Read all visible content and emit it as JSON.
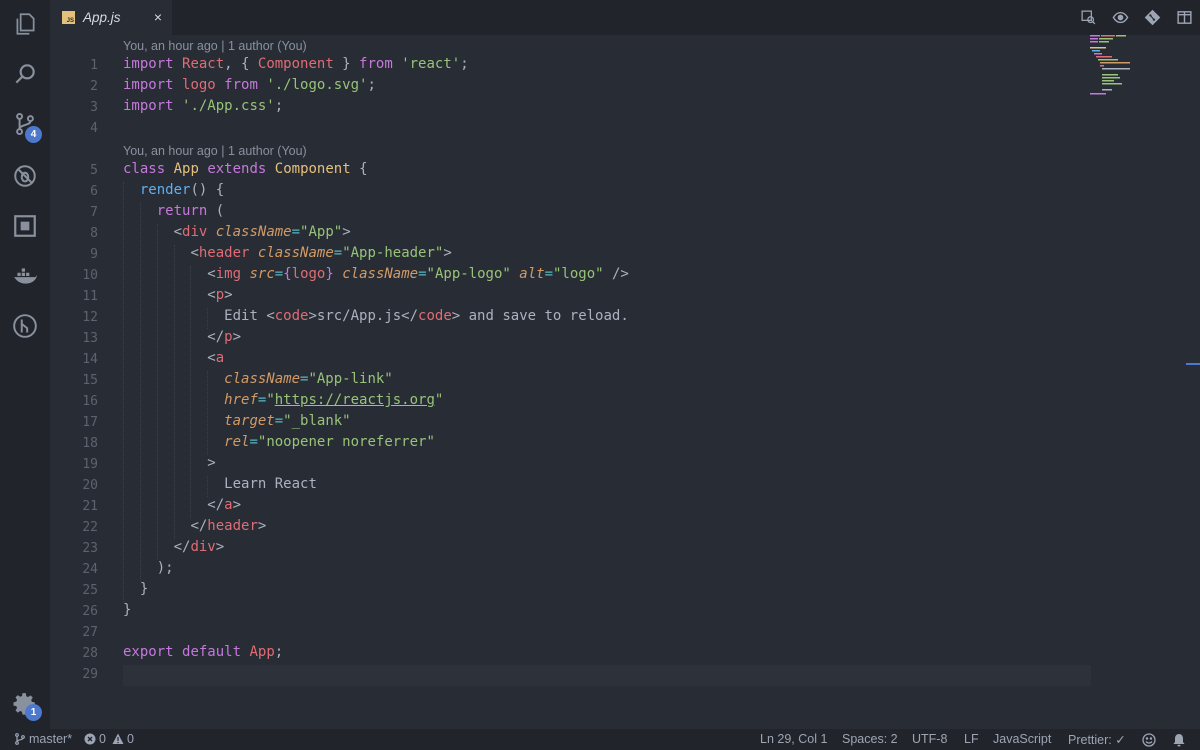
{
  "activity_bar": {
    "scm_badge": "4",
    "settings_badge": "1",
    "items": [
      "explorer-icon",
      "search-icon",
      "source-control-icon",
      "debug-icon",
      "extensions-icon",
      "docker-icon",
      "gitlens-icon",
      "gear-icon"
    ]
  },
  "tab": {
    "label": "App.js",
    "icon_text": "JS",
    "close": "×"
  },
  "editor_actions": [
    "open-changes-icon",
    "preview-icon",
    "git-compare-icon",
    "split-editor-icon"
  ],
  "codelens": {
    "first": "You, an hour ago | 1 author (You)",
    "second": "You, an hour ago | 1 author (You)"
  },
  "line_numbers": [
    "1",
    "2",
    "3",
    "4",
    "5",
    "6",
    "7",
    "8",
    "9",
    "10",
    "11",
    "12",
    "13",
    "14",
    "15",
    "16",
    "17",
    "18",
    "19",
    "20",
    "21",
    "22",
    "23",
    "24",
    "25",
    "26",
    "27",
    "28",
    "29"
  ],
  "code": {
    "l1": {
      "t1": "import",
      "t2": " ",
      "t3": "React",
      "t4": ", { ",
      "t5": "Component",
      "t6": " } ",
      "t7": "from",
      "t8": " ",
      "t9": "'react'",
      "t10": ";"
    },
    "l2": {
      "t1": "import",
      "t2": " ",
      "t3": "logo",
      "t4": " ",
      "t5": "from",
      "t6": " ",
      "t7": "'./logo.svg'",
      "t8": ";"
    },
    "l3": {
      "t1": "import",
      "t2": " ",
      "t3": "'./App.css'",
      "t4": ";"
    },
    "l5": {
      "t1": "class",
      "t2": " ",
      "t3": "App",
      "t4": " ",
      "t5": "extends",
      "t6": " ",
      "t7": "Component",
      "t8": " {"
    },
    "l6": {
      "t1": "render",
      "t2": "() {"
    },
    "l7": {
      "t1": "return",
      "t2": " ("
    },
    "l8": {
      "t1": "<",
      "t2": "div",
      "t3": " ",
      "t4": "className",
      "t5": "=",
      "t6": "\"App\"",
      "t7": ">"
    },
    "l9": {
      "t1": "<",
      "t2": "header",
      "t3": " ",
      "t4": "className",
      "t5": "=",
      "t6": "\"App-header\"",
      "t7": ">"
    },
    "l10": {
      "t1": "<",
      "t2": "img",
      "t3": " ",
      "t4": "src",
      "t5": "=",
      "t6": "{",
      "t7": "logo",
      "t8": "}",
      "t9": " ",
      "t10": "className",
      "t11": "=",
      "t12": "\"App-logo\"",
      "t13": " ",
      "t14": "alt",
      "t15": "=",
      "t16": "\"logo\"",
      "t17": " />"
    },
    "l11": {
      "t1": "<",
      "t2": "p",
      "t3": ">"
    },
    "l12": {
      "t1": "Edit ",
      "t2": "<",
      "t3": "code",
      "t4": ">src/App.js</",
      "t5": "code",
      "t6": "> and save to reload."
    },
    "l13": {
      "t1": "</",
      "t2": "p",
      "t3": ">"
    },
    "l14": {
      "t1": "<",
      "t2": "a"
    },
    "l15": {
      "t1": "className",
      "t2": "=",
      "t3": "\"App-link\""
    },
    "l16": {
      "t1": "href",
      "t2": "=",
      "t3": "\"",
      "t4": "https://reactjs.org",
      "t5": "\""
    },
    "l17": {
      "t1": "target",
      "t2": "=",
      "t3": "\"_blank\""
    },
    "l18": {
      "t1": "rel",
      "t2": "=",
      "t3": "\"noopener noreferrer\""
    },
    "l19": {
      "t1": ">"
    },
    "l20": {
      "t1": "Learn React"
    },
    "l21": {
      "t1": "</",
      "t2": "a",
      "t3": ">"
    },
    "l22": {
      "t1": "</",
      "t2": "header",
      "t3": ">"
    },
    "l23": {
      "t1": "</",
      "t2": "div",
      "t3": ">"
    },
    "l24": {
      "t1": ");"
    },
    "l25": {
      "t1": "}"
    },
    "l26": {
      "t1": "}"
    },
    "l28": {
      "t1": "export",
      "t2": " ",
      "t3": "default",
      "t4": " ",
      "t5": "App",
      "t6": ";"
    }
  },
  "status_bar": {
    "branch": "master*",
    "errors": "0",
    "warnings": "0",
    "position": "Ln 29, Col 1",
    "spaces": "Spaces: 2",
    "encoding": "UTF-8",
    "eol": "LF",
    "language": "JavaScript",
    "prettier": "Prettier: ✓"
  },
  "colors": {
    "background": "#282c34",
    "sidebar": "#21252b",
    "keyword": "#c678dd",
    "variable": "#e06c75",
    "class": "#e5c07b",
    "string": "#98c379",
    "function": "#61afef",
    "attribute": "#d19a66",
    "badge": "#4d78cc"
  }
}
